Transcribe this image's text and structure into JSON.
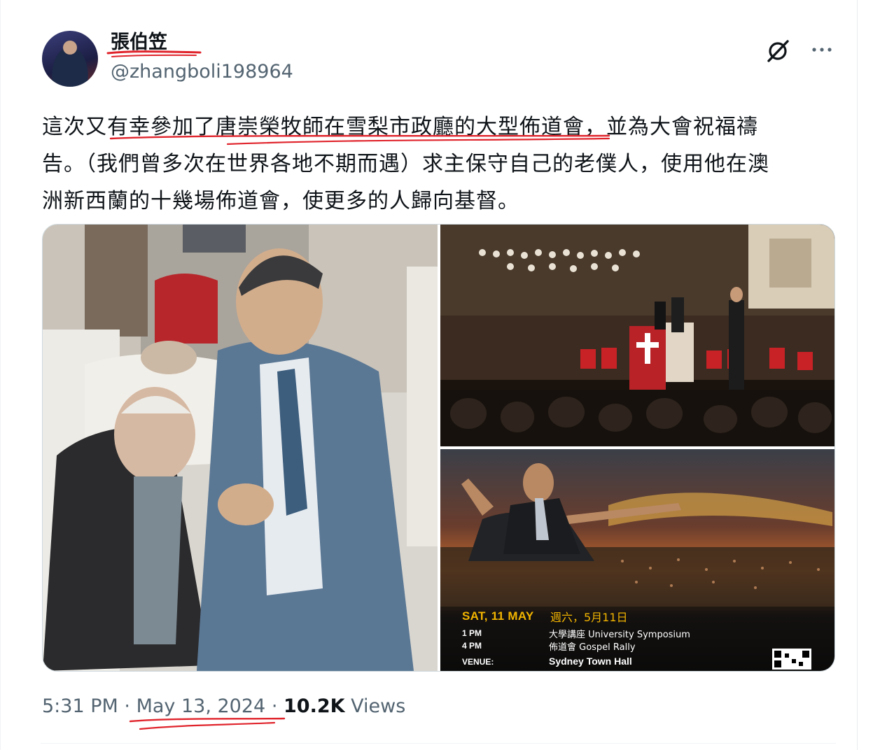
{
  "tweet": {
    "display_name": "張伯笠",
    "handle": "@zhangboli198964",
    "text_lines": [
      "這次又有幸參加了唐崇榮牧師在雪梨市政廳的大型佈道會，並為大會祝福禱",
      "告。（我們曾多次在世界各地不期而遇）求主保守自己的老僕人，使用他在澳",
      "洲新西蘭的十幾場佈道會，使更多的人歸向基督。"
    ],
    "time": "5:31 PM",
    "separator": "·",
    "date": "May 13, 2024",
    "views_count": "10.2K",
    "views_label": "Views"
  },
  "icons": {
    "grok": "grok-icon",
    "more": "more-dots-icon"
  },
  "poster": {
    "date_en": "SAT, 11 MAY",
    "date_zh": "週六，5月11日",
    "row1_time": "1 PM",
    "row1_event": "大學講座 University Symposium",
    "row2_time": "4 PM",
    "row2_event": "佈道會 Gospel Rally",
    "venue_label": "VENUE:",
    "venue": "Sydney Town Hall"
  },
  "colors": {
    "accent_red": "#e0242c",
    "handle_gray": "#536471",
    "poster_gold": "#f2b400"
  }
}
